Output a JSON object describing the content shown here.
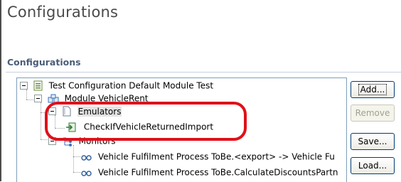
{
  "header": {
    "title": "Configurations"
  },
  "section": {
    "title": "Configurations"
  },
  "tree": {
    "root": "Test Configuration Default Module Test",
    "module": "Module VehicleRent",
    "emulators": "Emulators",
    "emulator_item": "CheckIfVehicleReturnedImport",
    "monitors": "Monitors",
    "monitor_items": [
      "Vehicle Fulfilment Process ToBe.<export> -> Vehicle Fu",
      "Vehicle Fulfilment Process ToBe.CalculateDiscountsPartn"
    ]
  },
  "buttons": {
    "add": "Add...",
    "remove": "Remove",
    "save": "Save...",
    "load": "Load..."
  },
  "colors": {
    "highlight": "#e0101a",
    "border": "#7f9db9"
  }
}
